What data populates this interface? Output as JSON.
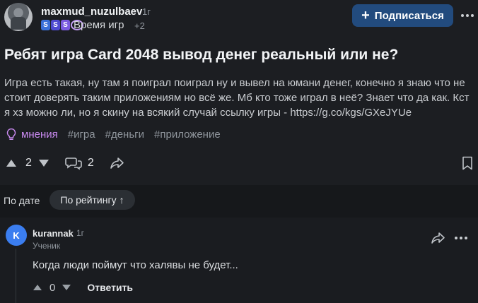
{
  "post": {
    "username": "maxmud_nuzulbaev",
    "age": "1г",
    "badges": [
      "S",
      "S",
      "S"
    ],
    "category": "Время игр",
    "category_extra": "+2",
    "subscribe_label": "Подписаться",
    "title": "Ребят игра Card 2048 вывод денег реальный или не?",
    "body": "Игра есть такая, ну там я поиграл поиграл ну и вывел на юмани денег, конечно я знаю что не стоит доверять таким приложениям но всё же. Мб кто тоже играл в неё? Знает что да как. Кст я хз можно ли, но я скину на всякий случай ссылку игры - https://g.co/kgs/GXeJYUe",
    "tags": {
      "main": "мнения",
      "items": [
        "#игра",
        "#деньги",
        "#приложение"
      ]
    },
    "votes": "2",
    "comments_count": "2"
  },
  "sort": {
    "label": "По дате",
    "active": "По рейтингу",
    "active_arrow": "↑"
  },
  "comment": {
    "avatar_letter": "K",
    "username": "kurannak",
    "age": "1г",
    "rank": "Ученик",
    "text": "Когда люди поймут что халявы не будет...",
    "votes": "0",
    "reply_label": "Ответить"
  },
  "colors": {
    "accent": "#224b7e",
    "tag_main": "#c98af0",
    "comment_avatar": "#3b7ef0"
  }
}
